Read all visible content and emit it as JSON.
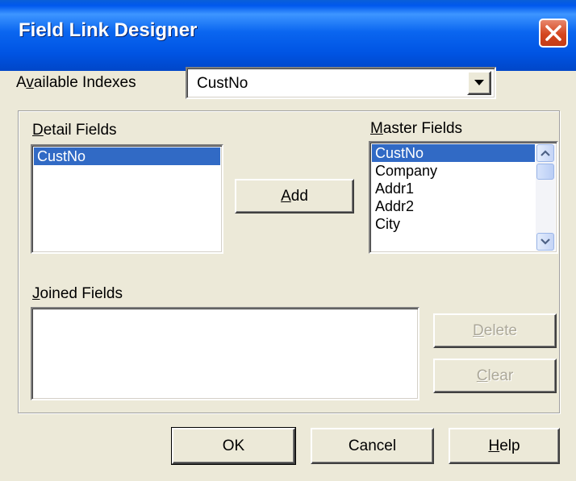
{
  "window": {
    "title": "Field Link Designer"
  },
  "indexes": {
    "label_pre": "A",
    "label_u": "v",
    "label_post": "ailable Indexes",
    "selected": "CustNo"
  },
  "detail": {
    "label_pre": "",
    "label_u": "D",
    "label_post": "etail Fields",
    "items": [
      "CustNo"
    ]
  },
  "master": {
    "label_pre": "",
    "label_u": "M",
    "label_post": "aster Fields",
    "items": [
      "CustNo",
      "Company",
      "Addr1",
      "Addr2",
      "City"
    ]
  },
  "joined": {
    "label_pre": "",
    "label_u": "J",
    "label_post": "oined Fields"
  },
  "buttons": {
    "add": {
      "u": "A",
      "post": "dd"
    },
    "delete": {
      "u": "D",
      "post": "elete"
    },
    "clear": {
      "u": "C",
      "post": "lear"
    },
    "ok": "OK",
    "cancel": "Cancel",
    "help": {
      "u": "H",
      "post": "elp"
    }
  }
}
